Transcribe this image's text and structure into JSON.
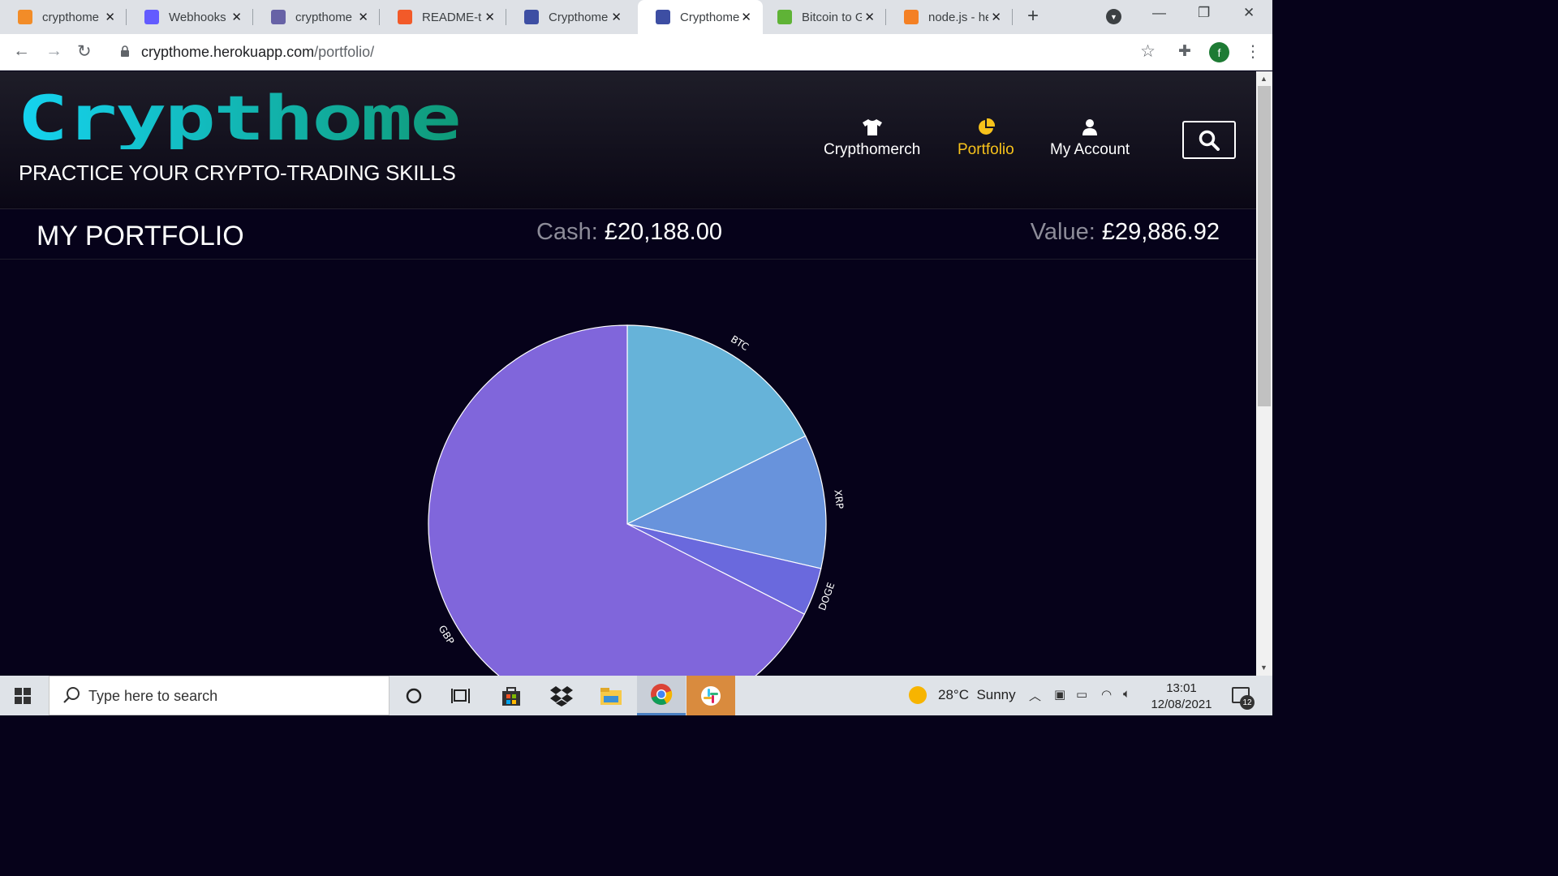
{
  "browser": {
    "tabs": [
      {
        "title": "crypthome",
        "favicon": "orange-box-icon",
        "color": "#f28c28"
      },
      {
        "title": "Webhooks",
        "favicon": "stripe-icon",
        "color": "#635bff"
      },
      {
        "title": "crypthome",
        "favicon": "heroku-icon",
        "color": "#6762a6"
      },
      {
        "title": "README-te",
        "favicon": "g-icon",
        "color": "#f25a29"
      },
      {
        "title": "Crypthome",
        "favicon": "bitcoin-b-icon",
        "color": "#3d4ea3"
      },
      {
        "title": "Crypthome",
        "favicon": "bitcoin-b-icon",
        "color": "#3d4ea3",
        "active": true
      },
      {
        "title": "Bitcoin to G",
        "favicon": "coin-icon",
        "color": "#5fb336"
      },
      {
        "title": "node.js - he",
        "favicon": "stackoverflow-icon",
        "color": "#f48024"
      }
    ],
    "url_host": "crypthome.herokuapp.com",
    "url_path": "/portfolio/",
    "profile_initial": "f"
  },
  "site": {
    "logo": "Crypthome",
    "tagline": "PRACTICE YOUR CRYPTO-TRADING SKILLS",
    "nav": [
      {
        "label": "Crypthomerch",
        "icon": "tshirt-icon"
      },
      {
        "label": "Portfolio",
        "icon": "pie-chart-icon",
        "active": true
      },
      {
        "label": "My Account",
        "icon": "user-icon"
      }
    ],
    "accent": "#f7c21b"
  },
  "portfolio": {
    "title": "MY PORTFOLIO",
    "cash_label": "Cash:",
    "cash_value": "£20,188.00",
    "value_label": "Value:",
    "value_value": "£29,886.92"
  },
  "chart_data": {
    "type": "pie",
    "title": "",
    "slices": [
      {
        "label": "BTC",
        "value": 17.7,
        "color": "#66b3d9"
      },
      {
        "label": "XRP",
        "value": 10.9,
        "color": "#6893dc"
      },
      {
        "label": "DOGE",
        "value": 3.9,
        "color": "#6a69dd"
      },
      {
        "label": "GBP",
        "value": 67.5,
        "color": "#8066db"
      }
    ]
  },
  "taskbar": {
    "search_placeholder": "Type here to search",
    "weather_temp": "28°C",
    "weather_text": "Sunny",
    "time": "13:01",
    "date": "12/08/2021",
    "notifications": "12"
  }
}
